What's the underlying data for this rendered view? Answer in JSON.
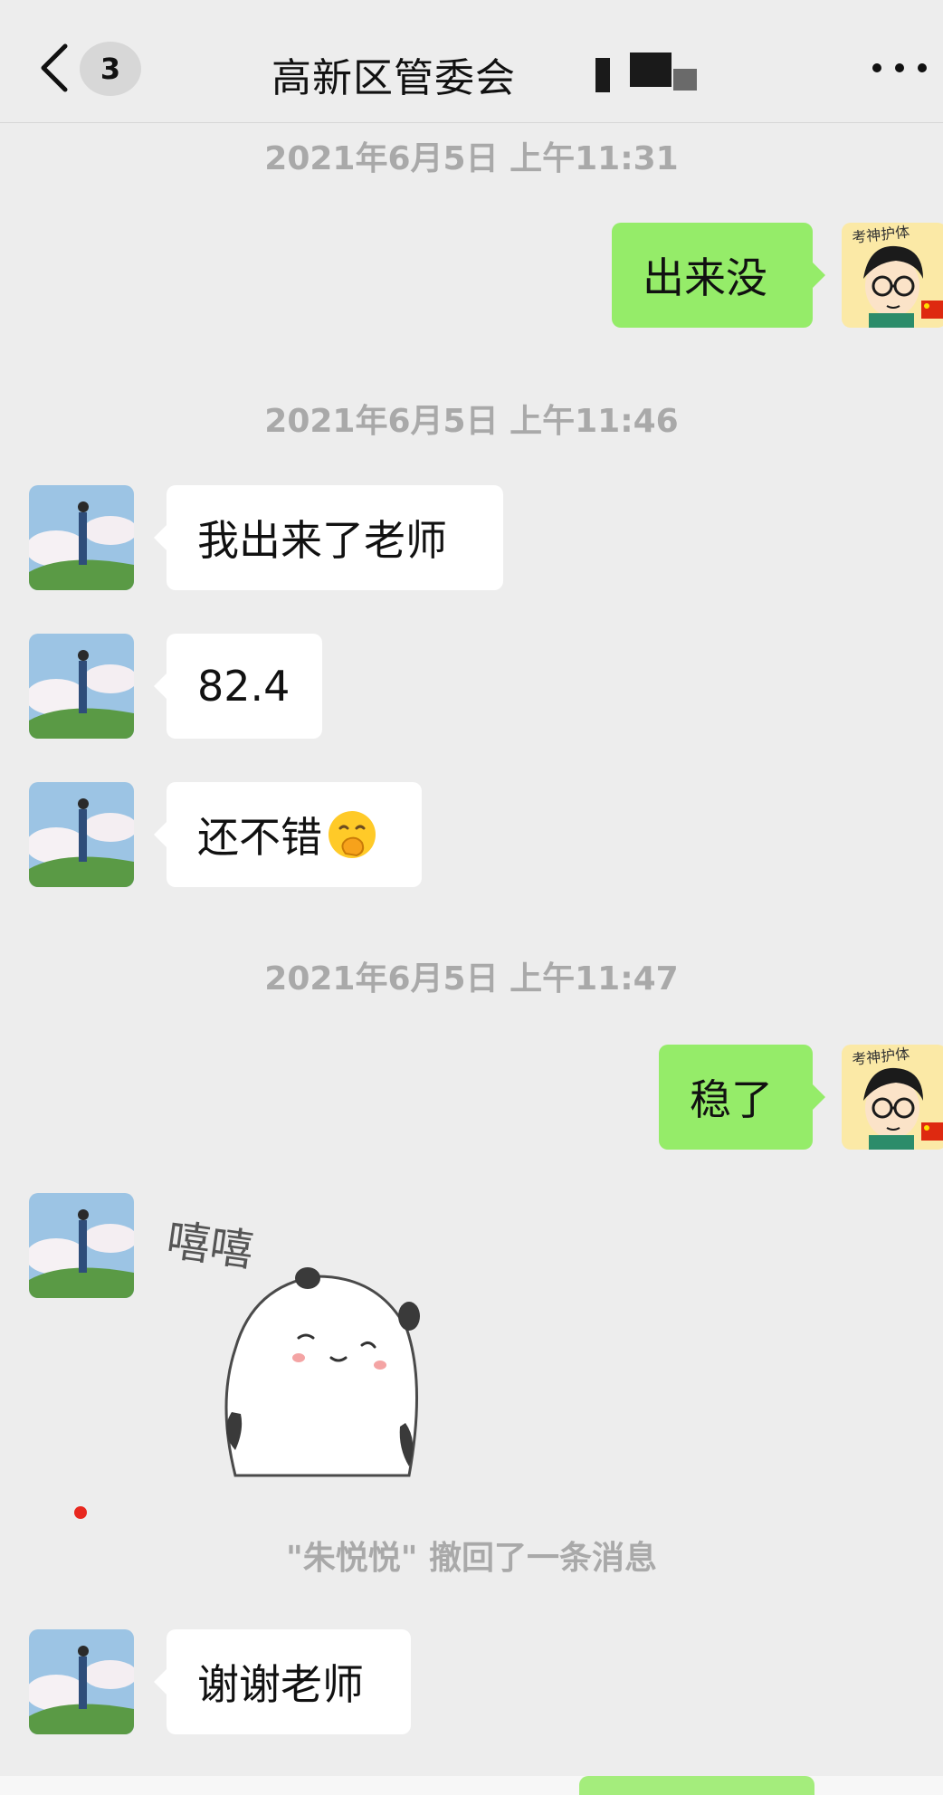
{
  "header": {
    "badge_count": "3",
    "title": "高新区管委会"
  },
  "colors": {
    "background": "#ededed",
    "incoming_bubble": "#ffffff",
    "outgoing_bubble": "#95ec69",
    "timestamp_text": "#a9a9a9"
  },
  "messages": {
    "ts1": "2021年6月5日 上午11:31",
    "m1": "出来没",
    "ts2": "2021年6月5日 上午11:46",
    "m2": "我出来了老师",
    "m3": "82.4",
    "m4": "还不错",
    "m4_emoji": "hand-over-mouth-emoji",
    "ts3": "2021年6月5日 上午11:47",
    "m5": "稳了",
    "sticker_text": "嘻嘻",
    "recall_notice": "\"朱悦悦\" 撤回了一条消息",
    "m7": "谢谢老师"
  },
  "avatars": {
    "self": "cartoon-boy-glasses-avatar",
    "self_caption": "考神护体",
    "contact": "landscape-person-clouds-avatar"
  }
}
